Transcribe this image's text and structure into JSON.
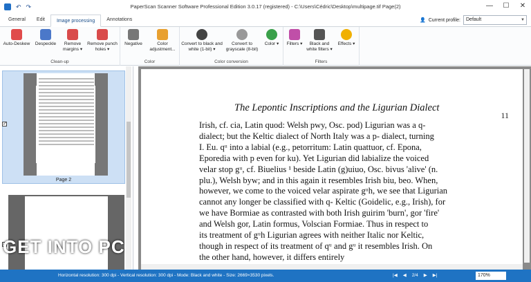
{
  "window": {
    "title": "PaperScan Scanner Software Professional Edition 3.0.17 (registered) - C:\\Users\\Cédric\\Desktop\\multipage.tif Page(2)",
    "min": "—",
    "max": "☐",
    "close": "✕"
  },
  "tabs": [
    "General",
    "Edit",
    "Image processing",
    "Annotations"
  ],
  "profile": {
    "label": "Current profile:",
    "value": "Default"
  },
  "ribbon": {
    "cleanup": {
      "label": "Clean-up",
      "autodeskew": "Auto-Deskew",
      "despeckle": "Despeckle",
      "remove_margins": "Remove margins ▾",
      "remove_holes": "Remove punch holes ▾"
    },
    "color": {
      "label": "Color",
      "negative": "Negative",
      "adjust": "Color adjustment..."
    },
    "conversion": {
      "label": "Color conversion",
      "bw": "Convert to black and white (1-bit) ▾",
      "gray": "Convert to grayscale (8-bit)",
      "color": "Color ▾"
    },
    "filters": {
      "label": "Filters",
      "filters": "Filters ▾",
      "bwfilters": "Black and white filters ▾",
      "effects": "Effects ▾"
    }
  },
  "thumbs": {
    "page2": "Page 2"
  },
  "watermark": "GET INTO PC",
  "document": {
    "title": "The Lepontic Inscriptions and the Ligurian Dialect",
    "page": "11",
    "lines": [
      "Irish, cf. cia, Latin quod: Welsh pwy, Osc. pod) Ligurian was a q-",
      "dialect; but the Keltic dialect of North Italy was a p- dialect, turning",
      "I. Eu. qᵘ into a labial (e.g., petorritum: Latin quattuor, cf. Epona,",
      "Eporedia with p even for ku). Yet Ligurian did labialize the voiced",
      "velar stop gᵘ, cf. Biuelius ¹ beside Latin (g)uiuo, Osc. bivus 'alive' (n.",
      "plu.), Welsh byw; and in this again it resembles Irish biu, beo. When,",
      "however, we come to the voiced velar aspirate gᵘh, we see that Ligurian",
      "cannot any longer be classified with q- Keltic (Goidelic, e.g., Irish), for",
      "we have Bormiae as contrasted with both Irish guirim 'burn', gor 'fire'",
      "and Welsh gor, Latin formus, Volscian Formiae. Thus in respect to",
      "its treatment of gᵘh Ligurian agrees with neither Italic nor Keltic,",
      "though in respect of its treatment of qᵘ and gᵘ it resembles Irish. On",
      "the other hand, however, it differs entirely"
    ]
  },
  "status": {
    "text": "Horizontal resolution: 300 dpi - Vertical resolution: 300 dpi - Mode: Black and white - Size: 2669×3530 pixels.",
    "page": "2/4",
    "zoom": "170%"
  }
}
